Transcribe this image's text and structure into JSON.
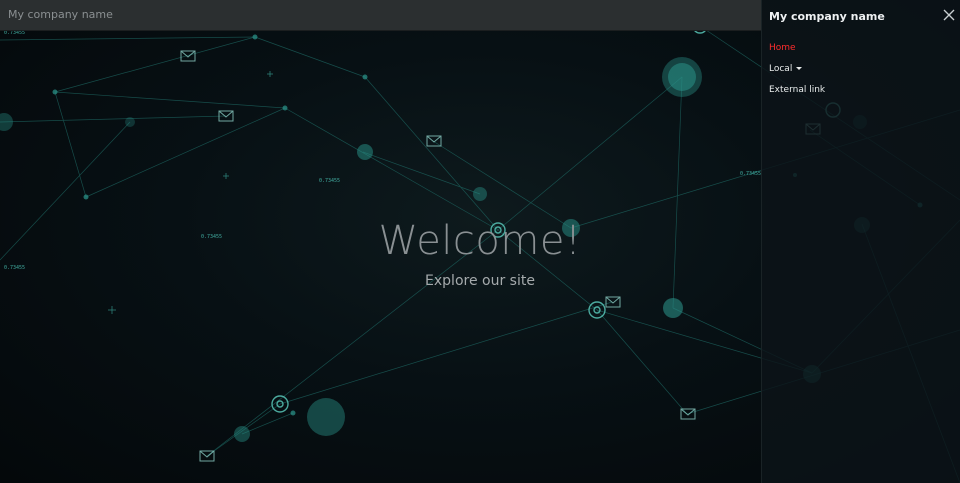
{
  "header": {
    "brand": "My company name"
  },
  "hero": {
    "title": "Welcome!",
    "subtitle": "Explore our site"
  },
  "sidebar": {
    "brand": "My company name",
    "items": [
      {
        "label": "Home",
        "active": true
      },
      {
        "label": "Local",
        "has_dropdown": true
      },
      {
        "label": "External link"
      }
    ]
  },
  "background_labels": [
    "0.73455",
    "0.73455",
    "0.73455",
    "0.73455",
    "0.73455"
  ],
  "colors": {
    "accent": "#2fb3a3",
    "active_link": "#ff2d2d",
    "topbar": "#2b2f30"
  }
}
